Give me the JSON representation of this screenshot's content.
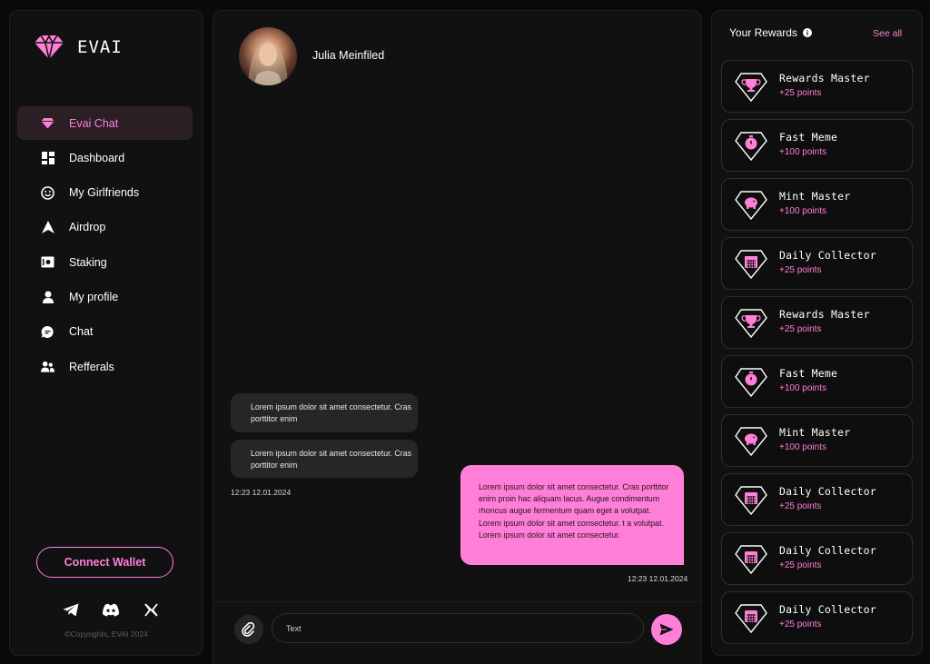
{
  "brand": {
    "name": "EVAI",
    "accent": "#ff7fd8"
  },
  "sidebar": {
    "items": [
      {
        "label": "Evai Chat",
        "icon": "diamond-icon",
        "active": true
      },
      {
        "label": "Dashboard",
        "icon": "grid-icon"
      },
      {
        "label": "My Girlfriends",
        "icon": "smiley-icon"
      },
      {
        "label": "Airdrop",
        "icon": "arrow-up-icon"
      },
      {
        "label": "Staking",
        "icon": "vault-icon"
      },
      {
        "label": "My profile",
        "icon": "person-icon"
      },
      {
        "label": "Chat",
        "icon": "chat-bubble-icon"
      },
      {
        "label": "Refferals",
        "icon": "users-icon"
      }
    ],
    "connect_label": "Connect Wallet",
    "socials": [
      "telegram-icon",
      "discord-icon",
      "x-icon"
    ],
    "copyright": "©Copyrights, EVAI 2024"
  },
  "chat": {
    "contact_name": "Julia Meinfiled",
    "messages": {
      "in1": "Lorem ipsum dolor sit amet consectetur. Cras porttitor enim",
      "in2": "Lorem ipsum dolor sit amet consectetur. Cras porttitor enim",
      "in_time": "12:23 12.01.2024",
      "out1": "Lorem ipsum dolor sit amet consectetur. Cras porttitor enim proin hac aliquam lacus. Augue condimentum rhoncus augue fermentum quam eget a volutpat. Lorem ipsum dolor sit amet consectetur. t a volutpat. Lorem ipsum dolor sit amet consectetur.",
      "out_time": "12:23 12.01.2024"
    },
    "input_placeholder": "Text"
  },
  "rewards": {
    "title": "Your Rewards",
    "see_all": "See all",
    "items": [
      {
        "name": "Rewards Master",
        "points": "+25 points",
        "icon": "trophy-icon"
      },
      {
        "name": "Fast Meme",
        "points": "+100 points",
        "icon": "timer-icon"
      },
      {
        "name": "Mint Master",
        "points": "+100 points",
        "icon": "piggy-bank-icon"
      },
      {
        "name": "Daily Collector",
        "points": "+25 points",
        "icon": "calendar-icon"
      },
      {
        "name": "Rewards Master",
        "points": "+25 points",
        "icon": "trophy-icon"
      },
      {
        "name": "Fast Meme",
        "points": "+100 points",
        "icon": "timer-icon"
      },
      {
        "name": "Mint Master",
        "points": "+100 points",
        "icon": "piggy-bank-icon"
      },
      {
        "name": "Daily Collector",
        "points": "+25 points",
        "icon": "calendar-icon"
      },
      {
        "name": "Daily Collector",
        "points": "+25 points",
        "icon": "calendar-icon"
      },
      {
        "name": "Daily Collector",
        "points": "+25 points",
        "icon": "calendar-icon"
      }
    ]
  }
}
